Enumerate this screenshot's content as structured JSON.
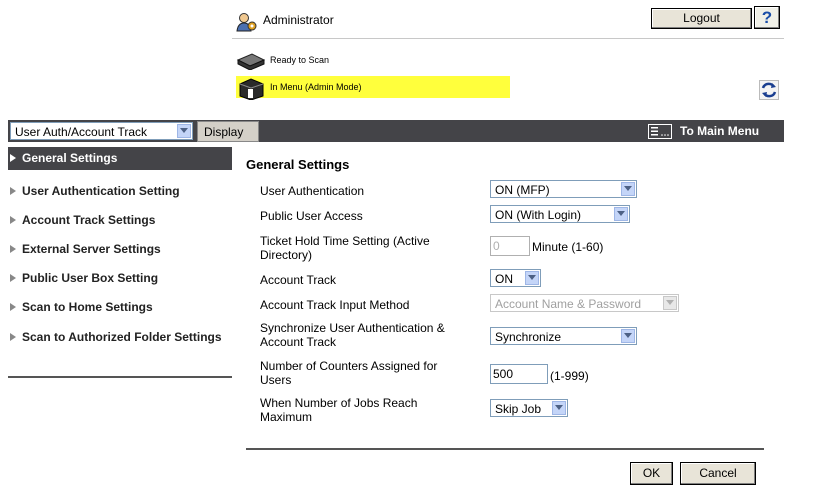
{
  "header": {
    "user_label": "Administrator",
    "logout_label": "Logout",
    "help_label": "?",
    "status_ready": "Ready to Scan",
    "status_menu": "In Menu (Admin Mode)",
    "highlight_color": "#ffff3c"
  },
  "toolbar": {
    "nav_select_value": "User Auth/Account Track",
    "display_label": "Display",
    "main_menu_label": "To Main Menu"
  },
  "sidebar": {
    "items": [
      {
        "label": "General Settings",
        "active": true
      },
      {
        "label": "User Authentication Setting"
      },
      {
        "label": "Account Track Settings"
      },
      {
        "label": "External Server Settings"
      },
      {
        "label": "Public User Box Setting"
      },
      {
        "label": "Scan to Home Settings"
      },
      {
        "label": "Scan to Authorized Folder Settings"
      }
    ]
  },
  "main": {
    "title": "General Settings",
    "rows": [
      {
        "label": "User Authentication",
        "value": "ON (MFP)"
      },
      {
        "label": "Public User Access",
        "value": "ON (With Login)"
      },
      {
        "label": "Ticket Hold Time Setting (Active Directory)",
        "value": "0",
        "unit": "Minute (1-60)"
      },
      {
        "label": "Account Track",
        "value": "ON"
      },
      {
        "label": "Account Track Input Method",
        "value": "Account Name & Password"
      },
      {
        "label": "Synchronize User Authentication & Account Track",
        "value": "Synchronize"
      },
      {
        "label": "Number of Counters Assigned for Users",
        "value": "500",
        "unit": "(1-999)"
      },
      {
        "label": "When Number of Jobs Reach Maximum",
        "value": "Skip Job"
      }
    ],
    "ok_label": "OK",
    "cancel_label": "Cancel"
  },
  "icons": {
    "admin": "administrator-icon",
    "scanner": "scanner-icon",
    "printer": "printer-icon",
    "refresh": "refresh-icon",
    "main_menu": "main-menu-icon"
  }
}
